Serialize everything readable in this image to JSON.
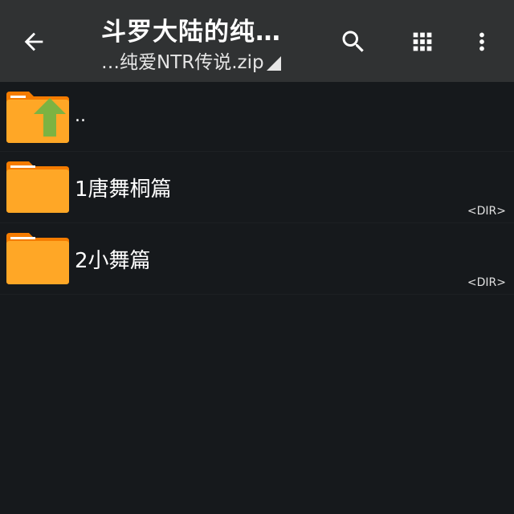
{
  "toolbar": {
    "title": "斗罗大陆的纯…",
    "subtitle": "…纯爱NTR传说.zip",
    "icons": [
      "arrow-back-icon",
      "search-icon",
      "grid-view-icon",
      "more-vert-icon"
    ]
  },
  "files": [
    {
      "name": "..",
      "meta": "",
      "type": "parent-folder"
    },
    {
      "name": "1唐舞桐篇",
      "meta": "<DIR>",
      "type": "folder"
    },
    {
      "name": "2小舞篇",
      "meta": "<DIR>",
      "type": "folder"
    }
  ],
  "colors": {
    "toolbar_bg": "#303233",
    "content_bg": "#16191c",
    "folder_body": "#ffa726",
    "folder_tab": "#f57c00",
    "up_arrow": "#7cb342"
  }
}
